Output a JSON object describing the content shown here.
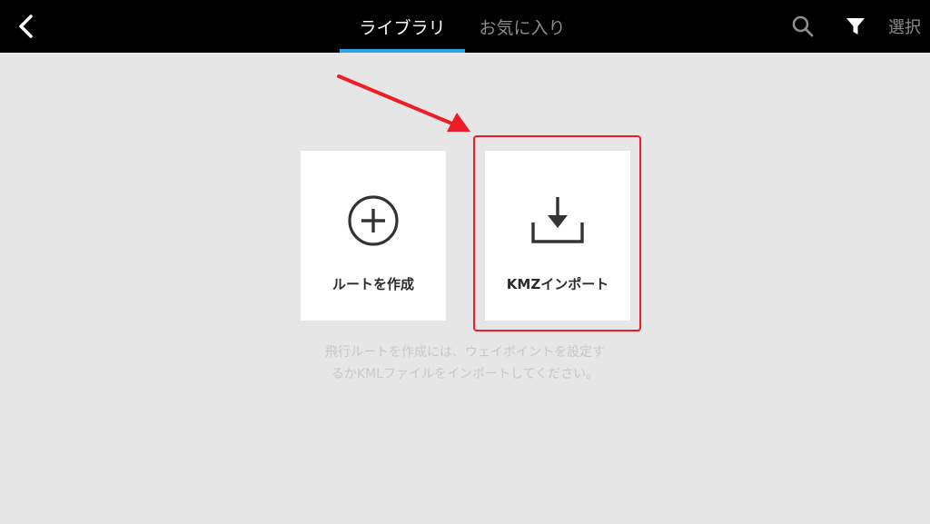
{
  "header": {
    "tabs": [
      {
        "label": "ライブラリ",
        "active": true
      },
      {
        "label": "お気に入り",
        "active": false
      }
    ],
    "select_label": "選択",
    "icons": {
      "back": "chevron-left-icon",
      "search": "search-icon",
      "filter": "filter-icon"
    }
  },
  "cards": [
    {
      "label": "ルートを作成",
      "icon": "plus-circle-icon"
    },
    {
      "label": "KMZインポート",
      "icon": "download-tray-icon"
    }
  ],
  "hint": {
    "line1": "飛行ルートを作成には、ウェイポイントを設定す",
    "line2": "るかKMLファイルをインポートしてください。"
  },
  "colors": {
    "accent": "#2aa2e6",
    "annotation": "#ee1c25",
    "background": "#e6e6e6",
    "topbar": "#000000"
  }
}
